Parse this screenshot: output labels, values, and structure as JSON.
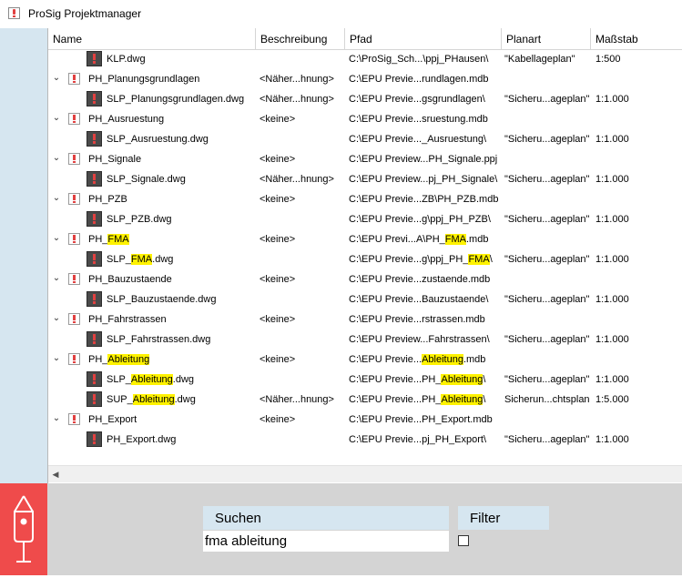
{
  "app": {
    "title": "ProSig Projektmanager"
  },
  "columns": {
    "name": "Name",
    "beschreibung": "Beschreibung",
    "pfad": "Pfad",
    "planart": "Planart",
    "massstab": "Maßstab"
  },
  "rows": [
    {
      "type": "file",
      "indent": 1,
      "name": [
        {
          "t": "KLP.dwg"
        }
      ],
      "beschreibung": "",
      "pfad": [
        {
          "t": "C:\\ProSig_Sch...\\ppj_PHausen\\"
        }
      ],
      "planart": "\"Kabellageplan\"",
      "massstab": "1:500"
    },
    {
      "type": "folder",
      "indent": 0,
      "name": [
        {
          "t": "PH_Planungsgrundlagen"
        }
      ],
      "beschreibung": "<Näher...hnung>",
      "pfad": [
        {
          "t": "C:\\EPU Previe...rundlagen.mdb"
        }
      ],
      "planart": "",
      "massstab": ""
    },
    {
      "type": "file",
      "indent": 1,
      "name": [
        {
          "t": "SLP_Planungsgrundlagen.dwg"
        }
      ],
      "beschreibung": "<Näher...hnung>",
      "pfad": [
        {
          "t": "C:\\EPU Previe...gsgrundlagen\\"
        }
      ],
      "planart": "\"Sicheru...ageplan\"",
      "massstab": "1:1.000"
    },
    {
      "type": "folder",
      "indent": 0,
      "name": [
        {
          "t": "PH_Ausruestung"
        }
      ],
      "beschreibung": "<keine>",
      "pfad": [
        {
          "t": "C:\\EPU Previe...sruestung.mdb"
        }
      ],
      "planart": "",
      "massstab": ""
    },
    {
      "type": "file",
      "indent": 1,
      "name": [
        {
          "t": "SLP_Ausruestung.dwg"
        }
      ],
      "beschreibung": "",
      "pfad": [
        {
          "t": "C:\\EPU Previe..._Ausruestung\\"
        }
      ],
      "planart": "\"Sicheru...ageplan\"",
      "massstab": "1:1.000"
    },
    {
      "type": "folder",
      "indent": 0,
      "name": [
        {
          "t": "PH_Signale"
        }
      ],
      "beschreibung": "<keine>",
      "pfad": [
        {
          "t": "C:\\EPU Preview...PH_Signale.ppj"
        }
      ],
      "planart": "",
      "massstab": ""
    },
    {
      "type": "file",
      "indent": 1,
      "name": [
        {
          "t": "SLP_Signale.dwg"
        }
      ],
      "beschreibung": "<Näher...hnung>",
      "pfad": [
        {
          "t": "C:\\EPU Preview...pj_PH_Signale\\"
        }
      ],
      "planart": "\"Sicheru...ageplan\"",
      "massstab": "1:1.000"
    },
    {
      "type": "folder",
      "indent": 0,
      "name": [
        {
          "t": "PH_PZB"
        }
      ],
      "beschreibung": "<keine>",
      "pfad": [
        {
          "t": "C:\\EPU Previe...ZB\\PH_PZB.mdb"
        }
      ],
      "planart": "",
      "massstab": ""
    },
    {
      "type": "file",
      "indent": 1,
      "name": [
        {
          "t": "SLP_PZB.dwg"
        }
      ],
      "beschreibung": "",
      "pfad": [
        {
          "t": "C:\\EPU Previe...g\\ppj_PH_PZB\\"
        }
      ],
      "planart": "\"Sicheru...ageplan\"",
      "massstab": "1:1.000"
    },
    {
      "type": "folder",
      "indent": 0,
      "name": [
        {
          "t": "PH_"
        },
        {
          "t": "FMA",
          "hl": true
        }
      ],
      "beschreibung": "<keine>",
      "pfad": [
        {
          "t": "C:\\EPU Previ...A\\PH_"
        },
        {
          "t": "FMA",
          "hl": true
        },
        {
          "t": ".mdb"
        }
      ],
      "planart": "",
      "massstab": ""
    },
    {
      "type": "file",
      "indent": 1,
      "name": [
        {
          "t": "SLP_"
        },
        {
          "t": "FMA",
          "hl": true
        },
        {
          "t": ".dwg"
        }
      ],
      "beschreibung": "",
      "pfad": [
        {
          "t": "C:\\EPU Previe...g\\ppj_PH_"
        },
        {
          "t": "FMA",
          "hl": true
        },
        {
          "t": "\\"
        }
      ],
      "planart": "\"Sicheru...ageplan\"",
      "massstab": "1:1.000"
    },
    {
      "type": "folder",
      "indent": 0,
      "name": [
        {
          "t": "PH_Bauzustaende"
        }
      ],
      "beschreibung": "<keine>",
      "pfad": [
        {
          "t": "C:\\EPU Previe...zustaende.mdb"
        }
      ],
      "planart": "",
      "massstab": ""
    },
    {
      "type": "file",
      "indent": 1,
      "name": [
        {
          "t": "SLP_Bauzustaende.dwg"
        }
      ],
      "beschreibung": "",
      "pfad": [
        {
          "t": "C:\\EPU Previe...Bauzustaende\\"
        }
      ],
      "planart": "\"Sicheru...ageplan\"",
      "massstab": "1:1.000"
    },
    {
      "type": "folder",
      "indent": 0,
      "name": [
        {
          "t": "PH_Fahrstrassen"
        }
      ],
      "beschreibung": "<keine>",
      "pfad": [
        {
          "t": "C:\\EPU Previe...rstrassen.mdb"
        }
      ],
      "planart": "",
      "massstab": ""
    },
    {
      "type": "file",
      "indent": 1,
      "name": [
        {
          "t": "SLP_Fahrstrassen.dwg"
        }
      ],
      "beschreibung": "",
      "pfad": [
        {
          "t": "C:\\EPU Preview...Fahrstrassen\\"
        }
      ],
      "planart": "\"Sicheru...ageplan\"",
      "massstab": "1:1.000"
    },
    {
      "type": "folder",
      "indent": 0,
      "name": [
        {
          "t": "PH_"
        },
        {
          "t": "Ableitung",
          "hl": true
        }
      ],
      "beschreibung": "<keine>",
      "pfad": [
        {
          "t": "C:\\EPU Previe..."
        },
        {
          "t": "Ableitung",
          "hl": true
        },
        {
          "t": ".mdb"
        }
      ],
      "planart": "",
      "massstab": ""
    },
    {
      "type": "file",
      "indent": 1,
      "name": [
        {
          "t": "SLP_"
        },
        {
          "t": "Ableitung",
          "hl": true
        },
        {
          "t": ".dwg"
        }
      ],
      "beschreibung": "",
      "pfad": [
        {
          "t": "C:\\EPU Previe...PH_"
        },
        {
          "t": "Ableitung",
          "hl": true
        },
        {
          "t": "\\"
        }
      ],
      "planart": "\"Sicheru...ageplan\"",
      "massstab": "1:1.000"
    },
    {
      "type": "file",
      "indent": 1,
      "name": [
        {
          "t": "SUP_"
        },
        {
          "t": "Ableitung",
          "hl": true
        },
        {
          "t": ".dwg"
        }
      ],
      "beschreibung": "<Näher...hnung>",
      "pfad": [
        {
          "t": "C:\\EPU Previe...PH_"
        },
        {
          "t": "Ableitung",
          "hl": true
        },
        {
          "t": "\\"
        }
      ],
      "planart": "Sicherun...chtsplan",
      "massstab": "1:5.000"
    },
    {
      "type": "folder",
      "indent": 0,
      "name": [
        {
          "t": "PH_Export"
        }
      ],
      "beschreibung": "<keine>",
      "pfad": [
        {
          "t": "C:\\EPU Previe...PH_Export.mdb"
        }
      ],
      "planart": "",
      "massstab": ""
    },
    {
      "type": "file",
      "indent": 1,
      "name": [
        {
          "t": "PH_Export.dwg"
        }
      ],
      "beschreibung": "",
      "pfad": [
        {
          "t": "C:\\EPU Previe...pj_PH_Export\\"
        }
      ],
      "planart": "\"Sicheru...ageplan\"",
      "massstab": "1:1.000"
    }
  ],
  "search": {
    "label": "Suchen",
    "value": "fma ableitung"
  },
  "filter": {
    "label": "Filter",
    "checked": false
  },
  "colors": {
    "accent_blue": "#d6e6f0",
    "highlight": "#fff200",
    "logo_red": "#ef4b4b"
  }
}
